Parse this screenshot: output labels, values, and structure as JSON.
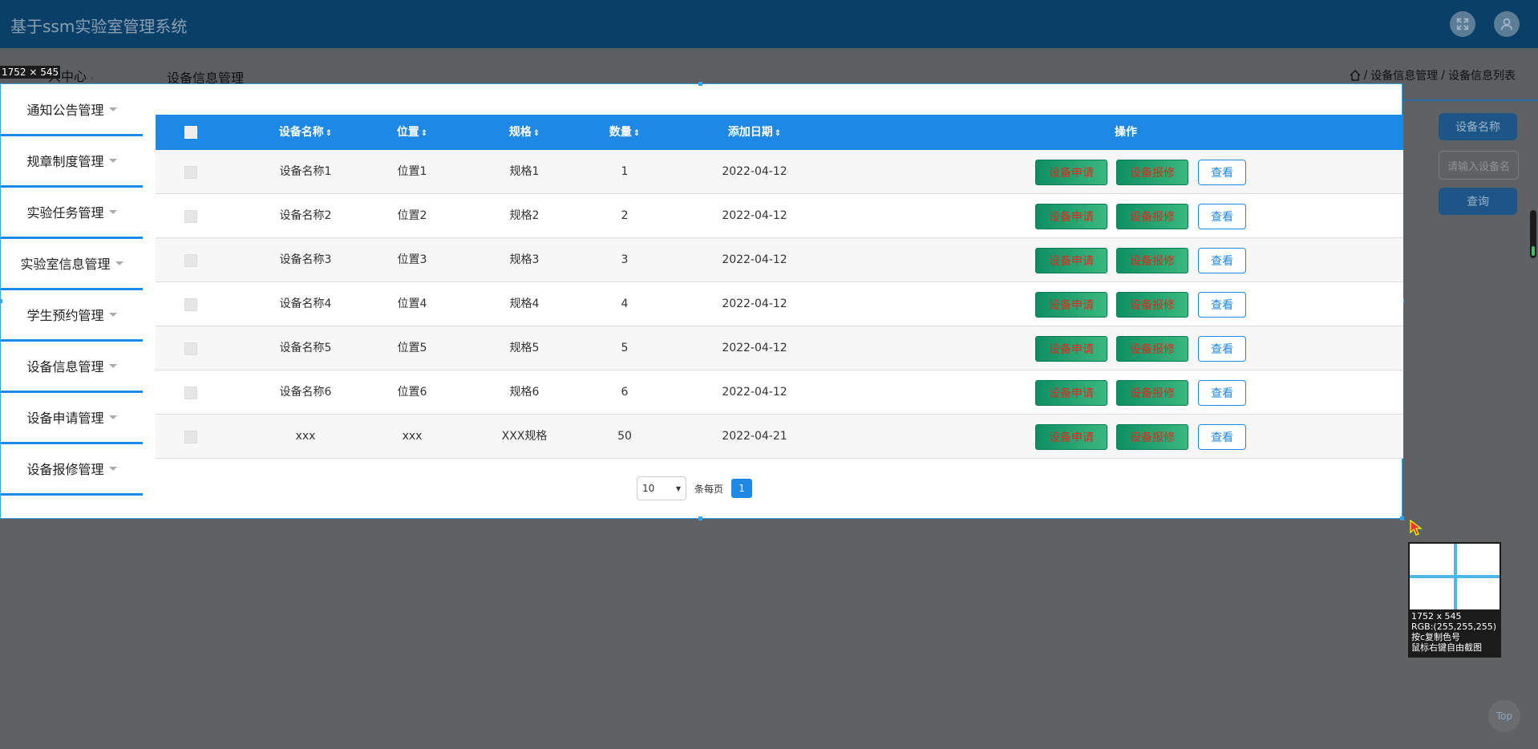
{
  "header": {
    "app_title": "基于ssm实验室管理系统",
    "fullscreen_icon": "fullscreen-icon",
    "user_icon": "user-icon"
  },
  "subbar": {
    "dimension_overlay": "1752 × 545",
    "user_center": "人中心",
    "page_heading": "设备信息管理",
    "breadcrumb": [
      "设备信息管理",
      "设备信息列表"
    ],
    "breadcrumb_sep": "/"
  },
  "sidebar": {
    "items": [
      {
        "label": "通知公告管理"
      },
      {
        "label": "规章制度管理"
      },
      {
        "label": "实验任务管理"
      },
      {
        "label": "实验室信息管理"
      },
      {
        "label": "学生预约管理"
      },
      {
        "label": "设备信息管理"
      },
      {
        "label": "设备申请管理"
      },
      {
        "label": "设备报修管理"
      }
    ]
  },
  "table": {
    "headers": [
      "设备名称",
      "位置",
      "规格",
      "数量",
      "添加日期",
      "操作"
    ],
    "rows": [
      {
        "name": "设备名称1",
        "location": "位置1",
        "spec": "规格1",
        "qty": "1",
        "date": "2022-04-12"
      },
      {
        "name": "设备名称2",
        "location": "位置2",
        "spec": "规格2",
        "qty": "2",
        "date": "2022-04-12"
      },
      {
        "name": "设备名称3",
        "location": "位置3",
        "spec": "规格3",
        "qty": "3",
        "date": "2022-04-12"
      },
      {
        "name": "设备名称4",
        "location": "位置4",
        "spec": "规格4",
        "qty": "4",
        "date": "2022-04-12"
      },
      {
        "name": "设备名称5",
        "location": "位置5",
        "spec": "规格5",
        "qty": "5",
        "date": "2022-04-12"
      },
      {
        "name": "设备名称6",
        "location": "位置6",
        "spec": "规格6",
        "qty": "6",
        "date": "2022-04-12"
      },
      {
        "name": "xxx",
        "location": "xxx",
        "spec": "XXX规格",
        "qty": "50",
        "date": "2022-04-21"
      }
    ],
    "actions": {
      "apply": "设备申请",
      "repair": "设备报修",
      "view": "查看"
    }
  },
  "pager": {
    "page_size": "10",
    "per_page_label": "条每页",
    "current_page": "1"
  },
  "right_panel": {
    "name_button": "设备名称",
    "search_placeholder": "请输入设备名",
    "query_button": "查询"
  },
  "magnifier": {
    "size": "1752 x 545",
    "rgb": "RGB:(255,255,255)",
    "hint_copy": "按c复制色号",
    "hint_capture": "鼠标右键自由截图"
  },
  "back_to_top": "Top",
  "colors": {
    "accent": "#1e88e5",
    "header_bg": "#0a3f67",
    "action_green": "#0e8f63",
    "action_text": "#e5271c"
  }
}
